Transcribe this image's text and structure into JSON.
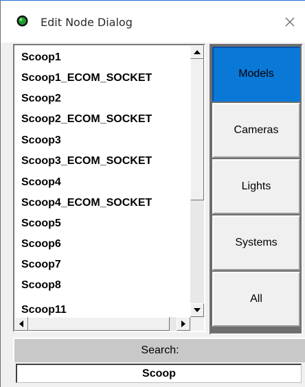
{
  "window": {
    "title": "Edit Node Dialog",
    "icon": "green-node-icon",
    "close_icon": "close-icon"
  },
  "node_list": {
    "items": [
      "Scoop1",
      "Scoop1_ECOM_SOCKET",
      "Scoop2",
      "Scoop2_ECOM_SOCKET",
      "Scoop3",
      "Scoop3_ECOM_SOCKET",
      "Scoop4",
      "Scoop4_ECOM_SOCKET",
      "Scoop5",
      "Scoop6",
      "Scoop7",
      "Scoop8",
      "Scoop11"
    ]
  },
  "categories": [
    {
      "label": "Models",
      "active": true
    },
    {
      "label": "Cameras",
      "active": false
    },
    {
      "label": "Lights",
      "active": false
    },
    {
      "label": "Systems",
      "active": false
    },
    {
      "label": "All",
      "active": false
    }
  ],
  "search": {
    "label": "Search:",
    "value": "Scoop"
  },
  "colors": {
    "active_category": "#0a78d7",
    "icon_green": "#1e9e2e"
  }
}
